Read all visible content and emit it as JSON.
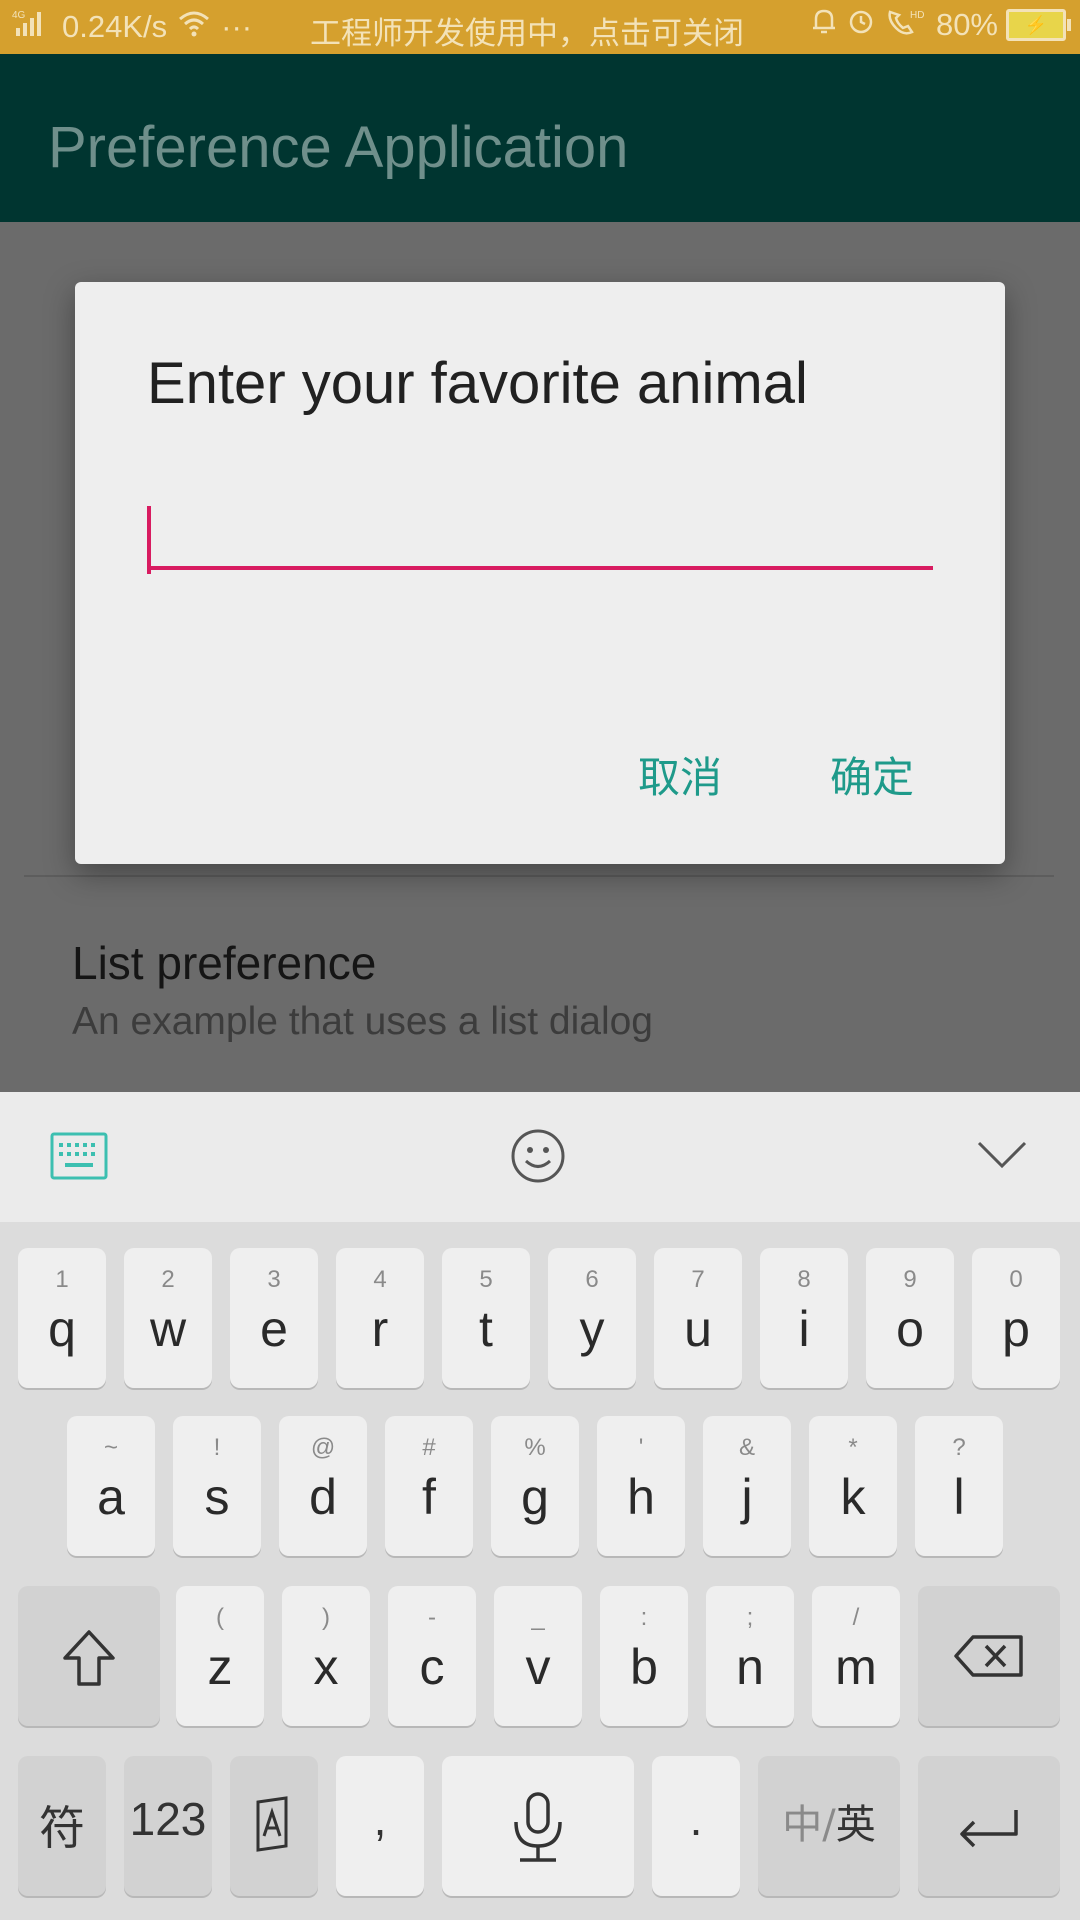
{
  "status_bar": {
    "network": "4G",
    "speed": "0.24K/s",
    "dots": "···",
    "notice": "工程师开发使用中，点击可关闭",
    "battery": "80%"
  },
  "app_bar": {
    "title": "Preference Application"
  },
  "background_list": {
    "item_title": "List preference",
    "item_summary": "An example that uses a list dialog"
  },
  "dialog": {
    "title": "Enter your favorite animal",
    "input_value": "",
    "cancel_label": "取消",
    "ok_label": "确定"
  },
  "keyboard": {
    "row1": [
      {
        "main": "q",
        "sub": "1"
      },
      {
        "main": "w",
        "sub": "2"
      },
      {
        "main": "e",
        "sub": "3"
      },
      {
        "main": "r",
        "sub": "4"
      },
      {
        "main": "t",
        "sub": "5"
      },
      {
        "main": "y",
        "sub": "6"
      },
      {
        "main": "u",
        "sub": "7"
      },
      {
        "main": "i",
        "sub": "8"
      },
      {
        "main": "o",
        "sub": "9"
      },
      {
        "main": "p",
        "sub": "0"
      }
    ],
    "row2": [
      {
        "main": "a",
        "sub": "~"
      },
      {
        "main": "s",
        "sub": "!"
      },
      {
        "main": "d",
        "sub": "@"
      },
      {
        "main": "f",
        "sub": "#"
      },
      {
        "main": "g",
        "sub": "%"
      },
      {
        "main": "h",
        "sub": "'"
      },
      {
        "main": "j",
        "sub": "&"
      },
      {
        "main": "k",
        "sub": "*"
      },
      {
        "main": "l",
        "sub": "?"
      }
    ],
    "row3": [
      {
        "main": "z",
        "sub": "("
      },
      {
        "main": "x",
        "sub": ")"
      },
      {
        "main": "c",
        "sub": "-"
      },
      {
        "main": "v",
        "sub": "_"
      },
      {
        "main": "b",
        "sub": ":"
      },
      {
        "main": "n",
        "sub": ";"
      },
      {
        "main": "m",
        "sub": "/"
      }
    ],
    "symbols_label": "符",
    "numbers_label": "123",
    "comma_label": ",",
    "period_label": ".",
    "lang_label_prefix": "中/",
    "lang_label_active": "英"
  },
  "colors": {
    "accent_teal": "#1e9a8a",
    "input_underline": "#d81b60",
    "app_bar": "#003530",
    "status_bar": "#d5a02e"
  }
}
